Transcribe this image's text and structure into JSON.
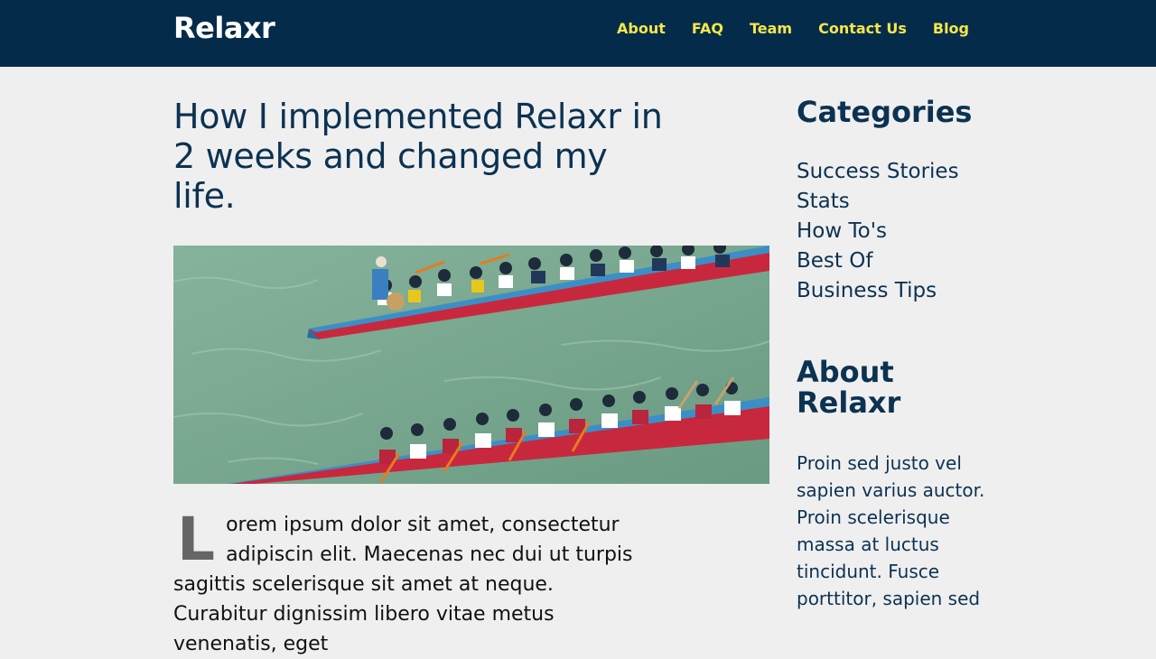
{
  "header": {
    "brand": "Relaxr",
    "nav": [
      {
        "label": "About"
      },
      {
        "label": "FAQ"
      },
      {
        "label": "Team"
      },
      {
        "label": "Contact Us"
      },
      {
        "label": "Blog"
      }
    ]
  },
  "post": {
    "title": "How I implemented Relaxr in 2 weeks and changed my life.",
    "hero_image": "dragon-boat-race-photo",
    "dropcap": "L",
    "body": "orem ipsum dolor sit amet, consectetur adipiscin elit. Maecenas nec dui ut turpis sagittis scelerisque sit amet at neque. Curabitur dignissim libero vitae metus venenatis, eget"
  },
  "sidebar": {
    "categories_heading": "Categories",
    "categories": [
      {
        "label": "Success Stories"
      },
      {
        "label": "Stats"
      },
      {
        "label": "How To's"
      },
      {
        "label": "Best Of"
      },
      {
        "label": "Business Tips"
      }
    ],
    "about_heading": "About Relaxr",
    "about_text": "Proin sed justo vel sapien varius auctor. Proin scelerisque massa at luctus tincidunt. Fusce porttitor, sapien sed"
  },
  "colors": {
    "header_bg": "#042c4a",
    "nav_link": "#f5e64b",
    "heading": "#0c3252",
    "page_bg": "#efefef"
  }
}
